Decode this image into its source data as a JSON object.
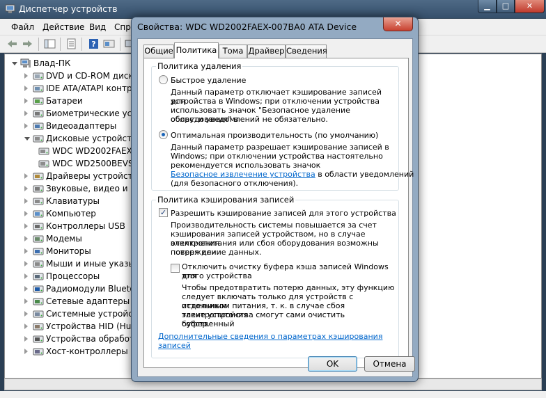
{
  "main_window": {
    "title": "Диспетчер устройств",
    "menu": [
      "Файл",
      "Действие",
      "Вид",
      "Спра"
    ],
    "computer": "Влад-ПК",
    "tree": [
      {
        "label": "DVD и CD-ROM диско",
        "icon": "dvd-drive-icon",
        "level": 1,
        "expanded": false
      },
      {
        "label": "IDE ATA/ATAPI контр",
        "icon": "ide-controller-icon",
        "level": 1,
        "expanded": false
      },
      {
        "label": "Батареи",
        "icon": "battery-icon",
        "level": 1,
        "expanded": false
      },
      {
        "label": "Биометрические устр",
        "icon": "fingerprint-icon",
        "level": 1,
        "expanded": false
      },
      {
        "label": "Видеоадаптеры",
        "icon": "display-adapter-icon",
        "level": 1,
        "expanded": false
      },
      {
        "label": "Дисковые устройства",
        "icon": "disk-drive-icon",
        "level": 1,
        "expanded": true
      },
      {
        "label": "WDC WD2002FAEX",
        "icon": "disk-drive-icon",
        "level": 2,
        "expanded": null
      },
      {
        "label": "WDC WD2500BEVS",
        "icon": "disk-drive-icon",
        "level": 2,
        "expanded": null
      },
      {
        "label": "Драйверы устройств",
        "icon": "driver-icon",
        "level": 1,
        "expanded": false
      },
      {
        "label": "Звуковые, видео и игр",
        "icon": "speaker-icon",
        "level": 1,
        "expanded": false
      },
      {
        "label": "Клавиатуры",
        "icon": "keyboard-icon",
        "level": 1,
        "expanded": false
      },
      {
        "label": "Компьютер",
        "icon": "computer-icon",
        "level": 1,
        "expanded": false
      },
      {
        "label": "Контроллеры USB",
        "icon": "usb-icon",
        "level": 1,
        "expanded": false
      },
      {
        "label": "Модемы",
        "icon": "modem-icon",
        "level": 1,
        "expanded": false
      },
      {
        "label": "Мониторы",
        "icon": "monitor-icon",
        "level": 1,
        "expanded": false
      },
      {
        "label": "Мыши и иные указыв",
        "icon": "mouse-icon",
        "level": 1,
        "expanded": false
      },
      {
        "label": "Процессоры",
        "icon": "processor-icon",
        "level": 1,
        "expanded": false
      },
      {
        "label": "Радиомодули Bluetoo",
        "icon": "bluetooth-icon",
        "level": 1,
        "expanded": false
      },
      {
        "label": "Сетевые адаптеры",
        "icon": "network-adapter-icon",
        "level": 1,
        "expanded": false
      },
      {
        "label": "Системные устройств",
        "icon": "system-device-icon",
        "level": 1,
        "expanded": false
      },
      {
        "label": "Устройства HID (Hum",
        "icon": "hid-icon",
        "level": 1,
        "expanded": false
      },
      {
        "label": "Устройства обработк",
        "icon": "imaging-device-icon",
        "level": 1,
        "expanded": false
      },
      {
        "label": "Хост-контроллеры ш",
        "icon": "bus-controller-icon",
        "level": 1,
        "expanded": false
      }
    ]
  },
  "dialog": {
    "title": "Свойства: WDC WD2002FAEX-007BA0 ATA Device",
    "tabs": [
      "Общие",
      "Политика",
      "Тома",
      "Драйвер",
      "Сведения"
    ],
    "selected_tab": "Политика",
    "removal_policy": {
      "title": "Политика удаления",
      "quick": {
        "label": "Быстрое удаление",
        "selected": false,
        "description": [
          "Данный параметр отключает кэширование записей для",
          "устройства в Windows; при отключении устройства",
          "использовать значок \"Безопасное удаление оборудования\" в",
          "области уведомлений не обязательно."
        ]
      },
      "optimal": {
        "label": "Оптимальная производительность (по умолчанию)",
        "selected": true,
        "description": [
          "Данный параметр разрешает кэширование записей в",
          "Windows; при отключении устройства настоятельно",
          "рекомендуется использовать значок"
        ],
        "link": "Безопасное извлечение устройства",
        "after_link": " в области уведомлений",
        "last_line": "(для безопасного отключения)."
      }
    },
    "write_cache_policy": {
      "title": "Политика кэширования записей",
      "enable": {
        "label": "Разрешить кэширование записей для этого устройства",
        "checked": true,
        "description": [
          "Производительность системы повышается за счет",
          "кэширования записей устройством, но в случае отключения",
          "электропитания или сбоя оборудования возможны потеря или",
          "повреждение данных."
        ]
      },
      "disable_flush": {
        "label": [
          "Отключить очистку буфера кэша записей Windows для",
          "этого устройства"
        ],
        "checked": false,
        "description": [
          "Чтобы предотвратить потерю данных, эту функцию",
          "следует включать только для устройств с отдельным",
          "источником питания, т. к.  в случае сбоя электропитания",
          "такие устройства смогут сами очистить собственный",
          "буфер."
        ]
      },
      "more_info_link": "Дополнительные сведения о параметрах кэширования записей"
    },
    "buttons": {
      "ok": "OK",
      "cancel": "Отмена"
    }
  }
}
